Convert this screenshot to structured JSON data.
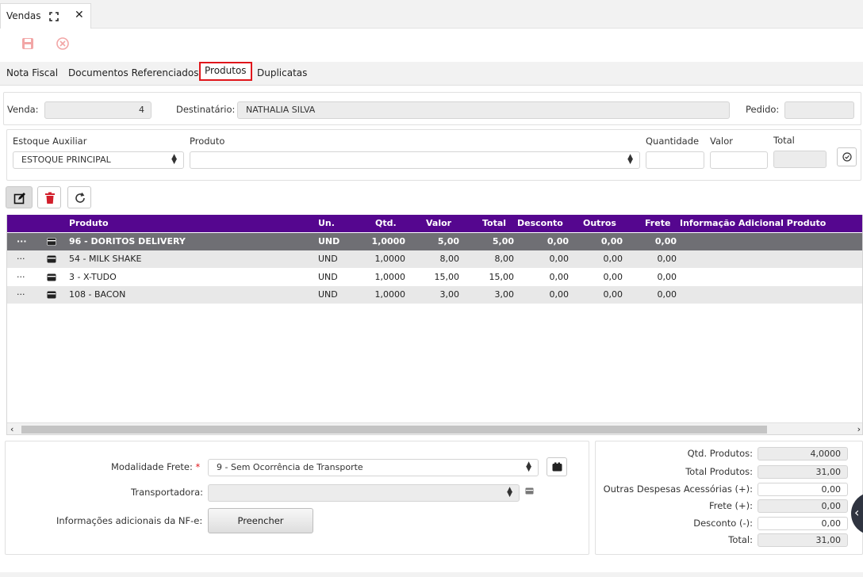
{
  "window": {
    "tab_title": "Vendas"
  },
  "section_tabs": [
    "Nota Fiscal",
    "Documentos Referenciados",
    "Produtos",
    "Duplicatas"
  ],
  "header": {
    "venda_label": "Venda:",
    "venda_value": "4",
    "destinatario_label": "Destinatário:",
    "destinatario_value": "NATHALIA SILVA",
    "pedido_label": "Pedido:",
    "pedido_value": ""
  },
  "add_item": {
    "estoque_label": "Estoque Auxiliar",
    "estoque_value": "ESTOQUE PRINCIPAL",
    "produto_label": "Produto",
    "produto_value": "",
    "quantidade_label": "Quantidade",
    "valor_label": "Valor",
    "total_label": "Total"
  },
  "grid": {
    "columns": [
      "Produto",
      "Un.",
      "Qtd.",
      "Valor",
      "Total",
      "Desconto",
      "Outros",
      "Frete",
      "Informação Adicional Produto"
    ],
    "rows": [
      {
        "produto": "96 - DORITOS DELIVERY",
        "un": "UND",
        "qtd": "1,0000",
        "valor": "5,00",
        "total": "5,00",
        "desconto": "0,00",
        "outros": "0,00",
        "frete": "0,00"
      },
      {
        "produto": "54 - MILK SHAKE",
        "un": "UND",
        "qtd": "1,0000",
        "valor": "8,00",
        "total": "8,00",
        "desconto": "0,00",
        "outros": "0,00",
        "frete": "0,00"
      },
      {
        "produto": "3 - X-TUDO",
        "un": "UND",
        "qtd": "1,0000",
        "valor": "15,00",
        "total": "15,00",
        "desconto": "0,00",
        "outros": "0,00",
        "frete": "0,00"
      },
      {
        "produto": "108 - BACON",
        "un": "UND",
        "qtd": "1,0000",
        "valor": "3,00",
        "total": "3,00",
        "desconto": "0,00",
        "outros": "0,00",
        "frete": "0,00"
      }
    ],
    "row_menu": "···"
  },
  "freight": {
    "modalidade_label": "Modalidade Frete:",
    "required_mark": "*",
    "modalidade_value": "9 - Sem Ocorrência de Transporte",
    "transportadora_label": "Transportadora:",
    "transportadora_value": "",
    "info_label": "Informações adicionais da NF-e:",
    "preencher_label": "Preencher"
  },
  "summary": {
    "qtd_produtos_label": "Qtd. Produtos:",
    "qtd_produtos_value": "4,0000",
    "total_produtos_label": "Total Produtos:",
    "total_produtos_value": "31,00",
    "outras_label": "Outras Despesas Acessórias (+):",
    "outras_value": "0,00",
    "frete_label": "Frete (+):",
    "frete_value": "0,00",
    "desconto_label": "Desconto (-):",
    "desconto_value": "0,00",
    "total_label": "Total:",
    "total_value": "31,00"
  },
  "colors": {
    "accent_purple": "#55068f",
    "active_tab_border": "#e0161b",
    "selected_row": "#6f6f74"
  }
}
